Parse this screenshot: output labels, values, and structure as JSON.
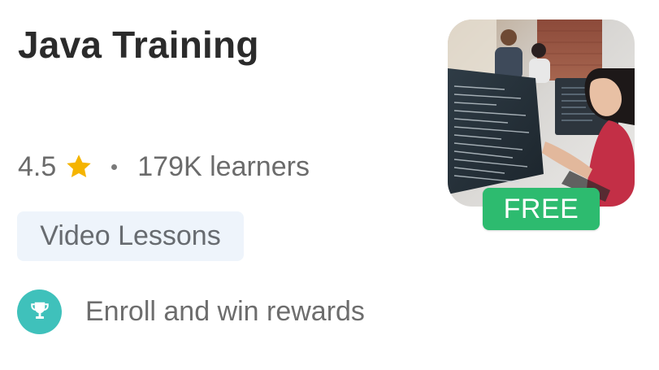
{
  "course": {
    "title": "Java Training",
    "rating": "4.5",
    "learners": "179K learners",
    "tag": "Video Lessons",
    "reward_text": "Enroll and win rewards",
    "badge": "FREE"
  },
  "icons": {
    "rating": "star-icon",
    "reward": "trophy-icon"
  },
  "colors": {
    "star": "#f5b400",
    "badge_bg": "#2dbb6f",
    "trophy_bg": "#3fc1bb",
    "chip_bg": "#eef4fb"
  }
}
